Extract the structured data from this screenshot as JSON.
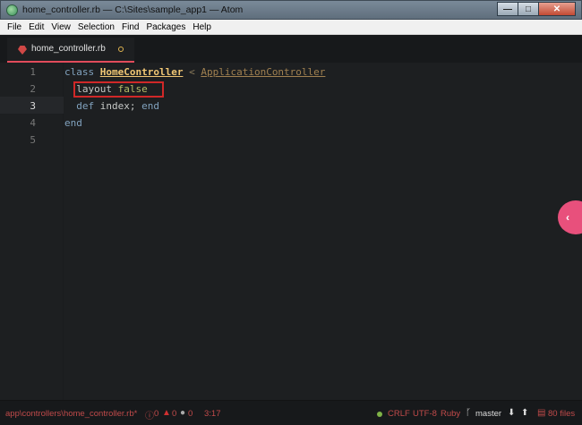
{
  "window": {
    "title": "home_controller.rb — C:\\Sites\\sample_app1 — Atom",
    "min_glyph": "—",
    "max_glyph": "□",
    "close_glyph": "✕"
  },
  "menu": [
    "File",
    "Edit",
    "View",
    "Selection",
    "Find",
    "Packages",
    "Help"
  ],
  "tab": {
    "title": "home_controller.rb"
  },
  "editor": {
    "line_numbers": [
      "1",
      "2",
      "3",
      "4",
      "5"
    ],
    "lines": [
      {
        "kw": "class",
        "cls": "HomeController",
        "op": "<",
        "sup": "ApplicationController"
      },
      {
        "ident": "layout",
        "bool": "false"
      },
      {
        "kw": "def",
        "ident": "index;",
        "kw2": "end"
      },
      {
        "kw": "end"
      }
    ]
  },
  "dock_arrow": "‹",
  "status": {
    "file_path": "app\\controllers\\home_controller.rb*",
    "errors": "0",
    "warnings": "0",
    "infos": "0",
    "cursor": "3:17",
    "line_ending": "CRLF",
    "encoding": "UTF-8",
    "grammar": "Ruby",
    "branch": "master",
    "files": "80 files"
  },
  "colors": {
    "accent": "#e24b5b",
    "pink_toggle": "#e8507c",
    "status_text": "#c04a4a"
  }
}
